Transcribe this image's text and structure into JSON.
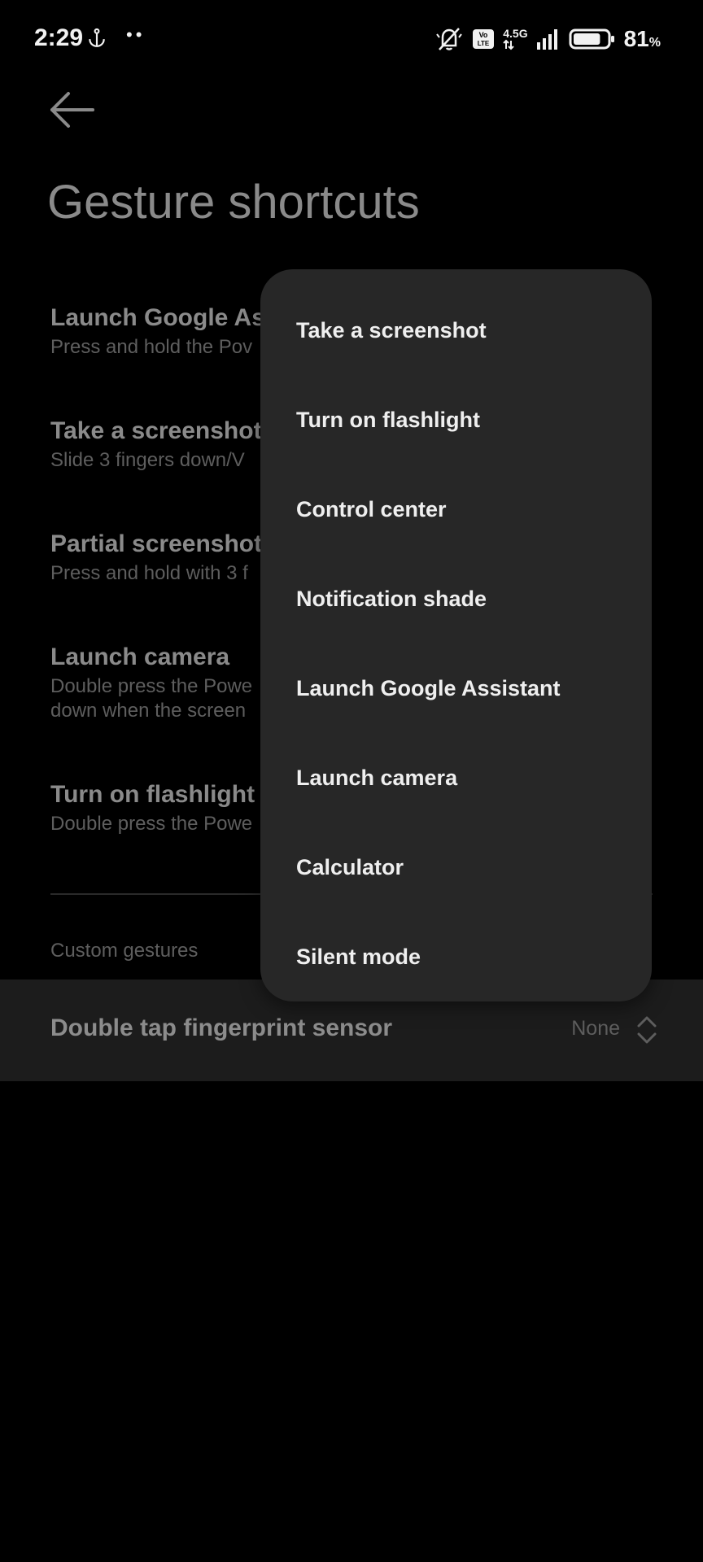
{
  "status_bar": {
    "time": "2:29",
    "dots": "••",
    "network": "4.5G",
    "volte": "Vo LTE",
    "battery_percent": "81",
    "battery_unit": "%",
    "battery_level": 0.81,
    "icons": [
      "anchor-icon",
      "silent-bell-icon",
      "volte-icon",
      "signal-icon",
      "battery-icon"
    ]
  },
  "header": {
    "back_icon": "back-arrow-icon",
    "title": "Gesture shortcuts"
  },
  "settings": [
    {
      "title": "Launch Google Assistant",
      "title_visible": "Launch Google As",
      "desc": "Press and hold the Pov"
    },
    {
      "title": "Take a screenshot",
      "title_visible": "Take a screenshot",
      "desc": "Slide 3 fingers down/V"
    },
    {
      "title": "Partial screenshot",
      "title_visible": "Partial screenshot",
      "desc": "Press and hold with 3 f"
    },
    {
      "title": "Launch camera",
      "title_visible": "Launch camera",
      "desc": "Double press the Powe",
      "desc2": "down when the screen"
    },
    {
      "title": "Turn on flashlight",
      "title_visible": "Turn on flashlight",
      "desc": "Double press the Powe"
    }
  ],
  "section": {
    "label": "Custom gestures"
  },
  "custom_gesture": {
    "label": "Double tap fingerprint sensor",
    "value": "None",
    "icon": "up-down-chevron-icon"
  },
  "popup_menu": {
    "items": [
      "Take a screenshot",
      "Turn on flashlight",
      "Control center",
      "Notification shade",
      "Launch Google Assistant",
      "Launch camera",
      "Calculator",
      "Silent mode"
    ]
  },
  "colors": {
    "background": "#000000",
    "popup_bg": "#272727",
    "highlight_row": "#1c1c1c"
  }
}
